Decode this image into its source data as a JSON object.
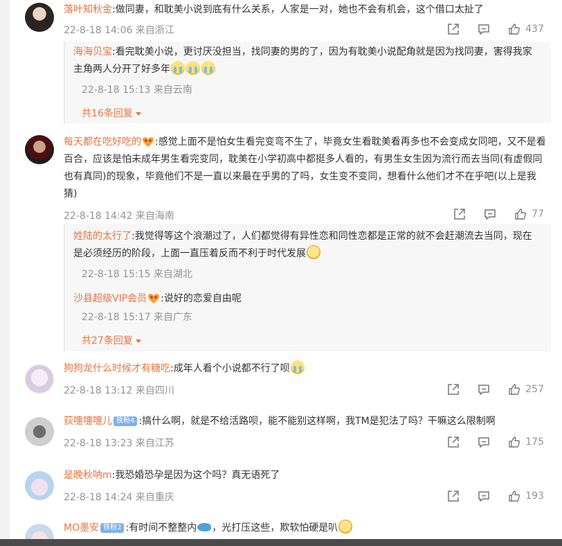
{
  "comments": [
    {
      "user": "落叶知秋金",
      "text": ":做同妻，和耽美小说到底有什么关系，人家是一对，她也不会有机会，这个借口太扯了",
      "time": "22-8-18 14:06",
      "location": "来自浙江",
      "likes": "437",
      "replies": [
        {
          "user": "海海贝宝",
          "text": ":看完耽美小说，更讨厌没担当，找同妻的男的了，因为有耽美小说配角就是因为找同妻，害得我家主角两人分开了好多年",
          "time": "22-8-18 15:13",
          "location": "来自云南"
        }
      ],
      "more_replies": "共16条回复"
    },
    {
      "user": "每天都在吃好吃的",
      "text": ":感觉上面不是怕女生看完变弯不生了，毕竟女生看耽美看再多也不会变成女同吧，又不是看百合，应该是怕未成年男生看完变同，耽美在小学初高中都挺多人看的，有男生女生因为流行而去当同(有虚假同也有真同)的现象，毕竟他们不是一直以来最在乎男的了吗，女生变不变同，想看什么他们才不在乎吧(以上是我猜)",
      "time": "22-8-18 14:42",
      "location": "来自海南",
      "likes": "77",
      "replies": [
        {
          "user": "姓陆的太行了",
          "text": ":我觉得等这个浪潮过了，人们都觉得有异性恋和同性恋都是正常的就不会赶潮流去当同，现在是必须经历的阶段，上面一直压着反而不利于时代发展",
          "time": "22-8-18 15:15",
          "location": "来自湖北"
        },
        {
          "user": "沙县超级VIP会员",
          "text": ":说好的恋爱自由呢",
          "time": "22-8-18 15:17",
          "location": "来自广东"
        }
      ],
      "more_replies": "共27条回复"
    },
    {
      "user": "狗狗龙什么时候才有糖吃",
      "text": ":成年人看个小说都不行了呗",
      "time": "22-8-18 13:12",
      "location": "来自四川",
      "likes": "257"
    },
    {
      "user": "荻嚏嚏嚏儿",
      "badge": "铁粉4",
      "text": ":搞什么啊，就是不给活路呗，能不能别这样啊，我TM是犯法了吗？干嘛这么限制啊",
      "time": "22-8-18 13:23",
      "location": "来自江苏",
      "likes": "175"
    },
    {
      "user": "是晚秋呐m",
      "text": ":我恐婚恐孕是因为这个吗？真无语死了",
      "time": "22-8-18 14:24",
      "location": "来自重庆",
      "likes": "193"
    },
    {
      "user": "MO墨安",
      "badge": "铁粉2",
      "text_a": ":有时间不整整内",
      "text_b": "，光打压这些，欺软怕硬是叭"
    }
  ],
  "icons": {
    "share": "share-icon",
    "comment": "comment-icon",
    "like": "like-icon",
    "emoji_cry": "crying-emoji",
    "emoji_smile": "smile-emoji",
    "emoji_heart": "heart-eyes-emoji",
    "fish": "fish-emoji"
  },
  "colors": {
    "username": "#eb7340",
    "meta": "#939393",
    "text": "#333333",
    "reply_bg": "#f7f7f7",
    "badge": "#7fb0ea"
  }
}
